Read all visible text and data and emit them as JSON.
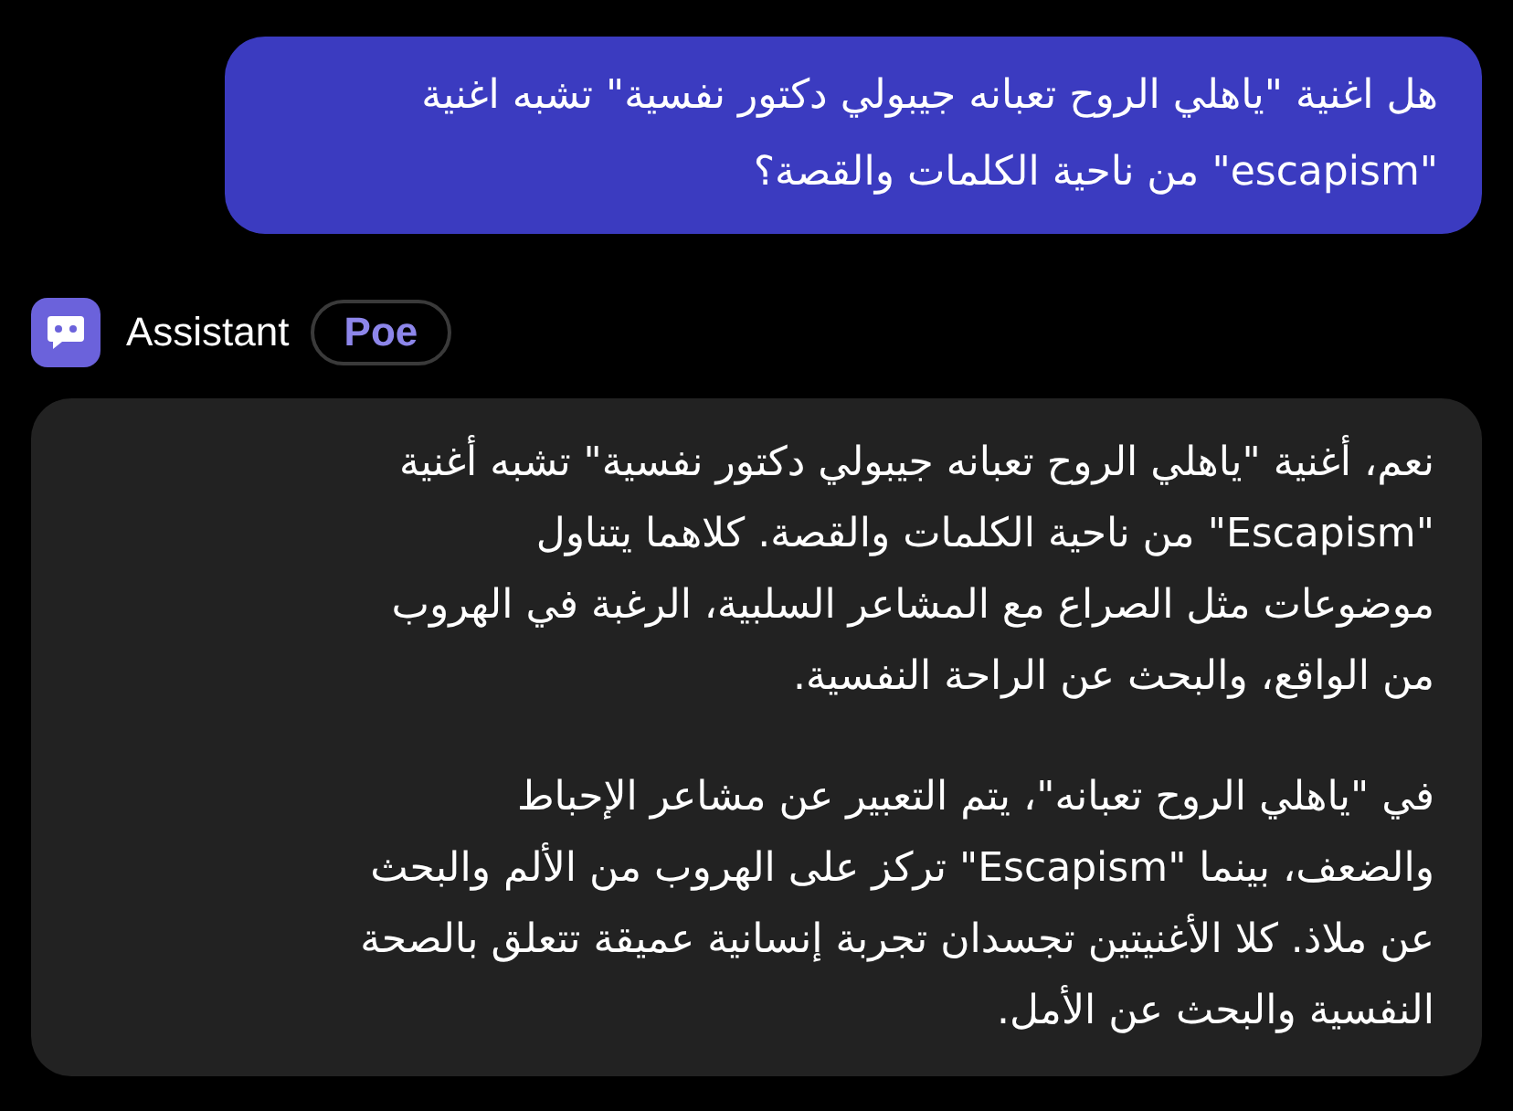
{
  "messages": [
    {
      "kind": "user",
      "text": "هل اغنية \"ياهلي الروح تعبانه جيبولي دكتور نفسية\" تشبه اغنية \"escapism\" من ناحية الكلمات والقصة؟"
    },
    {
      "kind": "bot",
      "sender": "Assistant",
      "badge": "Poe",
      "paragraphs": [
        "نعم، أغنية \"ياهلي الروح تعبانه جيبولي دكتور نفسية\" تشبه أغنية \"Escapism\" من ناحية الكلمات والقصة. كلاهما يتناول موضوعات مثل الصراع مع المشاعر السلبية، الرغبة في الهروب من الواقع، والبحث عن الراحة النفسية.",
        "في \"ياهلي الروح تعبانه\"، يتم التعبير عن مشاعر الإحباط والضعف، بينما \"Escapism\" تركز على الهروب من الألم والبحث عن ملاذ. كلا الأغنيتين تجسدان تجربة إنسانية عميقة تتعلق بالصحة النفسية والبحث عن الأمل."
      ]
    }
  ]
}
